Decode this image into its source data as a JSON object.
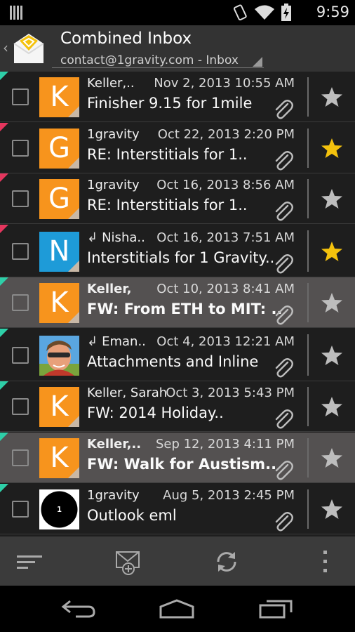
{
  "status_bar": {
    "time": "9:59",
    "icons": [
      "notification-icon",
      "rotate-icon",
      "wifi-icon",
      "battery-charging-icon"
    ]
  },
  "action_bar": {
    "title": "Combined Inbox",
    "account": "contact@1gravity.com - Inbox"
  },
  "messages": [
    {
      "sender": "Keller,..",
      "date": "Nov 2, 2013 10:55 AM",
      "subject": "Finisher 9.15 for 1mile",
      "avatar_letter": "K",
      "avatar_color": "#F7941D",
      "starred": false,
      "unread": false,
      "replied": false,
      "has_attachment": true,
      "account_color": "#2ECFA8"
    },
    {
      "sender": "1gravity",
      "date": "Oct 22, 2013 2:20 PM",
      "subject": "RE: Interstitials for 1..",
      "avatar_letter": "G",
      "avatar_color": "#F7941D",
      "starred": true,
      "unread": false,
      "replied": false,
      "has_attachment": true,
      "account_color": "#E5365E"
    },
    {
      "sender": "1gravity",
      "date": "Oct 16, 2013 8:56 AM",
      "subject": "RE: Interstitials for 1..",
      "avatar_letter": "G",
      "avatar_color": "#F7941D",
      "starred": false,
      "unread": false,
      "replied": false,
      "has_attachment": true,
      "account_color": "#E5365E"
    },
    {
      "sender": "Nisha..",
      "date": "Oct 16, 2013 7:51 AM",
      "subject": "Interstitials for 1 Gravity..",
      "avatar_letter": "N",
      "avatar_color": "#1E9BD8",
      "starred": true,
      "unread": false,
      "replied": true,
      "has_attachment": true,
      "account_color": "#E5365E"
    },
    {
      "sender": "Keller,",
      "date": "Oct 10, 2013 8:41 AM",
      "subject": "FW: From ETH to MIT: ..",
      "avatar_letter": "K",
      "avatar_color": "#F7941D",
      "starred": false,
      "unread": true,
      "replied": false,
      "has_attachment": true,
      "account_color": "#2ECFA8"
    },
    {
      "sender": "Eman..",
      "date": "Oct 4, 2013 12:21 AM",
      "subject": "Attachments and Inline",
      "avatar_letter": "",
      "avatar_color": "#3E8FD0",
      "starred": false,
      "unread": false,
      "replied": true,
      "has_attachment": true,
      "account_color": "#2ECFA8"
    },
    {
      "sender": "Keller, Sarah",
      "date": "Oct 3, 2013 5:43 PM",
      "subject": "FW: 2014 Holiday..",
      "avatar_letter": "K",
      "avatar_color": "#F7941D",
      "starred": false,
      "unread": false,
      "replied": false,
      "has_attachment": true,
      "account_color": "#2ECFA8"
    },
    {
      "sender": "Keller,..",
      "date": "Sep 12, 2013 4:11 PM",
      "subject": "FW: Walk for Austism..",
      "avatar_letter": "K",
      "avatar_color": "#F7941D",
      "starred": false,
      "unread": true,
      "replied": false,
      "has_attachment": true,
      "account_color": "#2ECFA8"
    },
    {
      "sender": "1gravity",
      "date": "Aug 5, 2013 2:45 PM",
      "subject": "Outlook eml",
      "avatar_letter": "1 gravity",
      "avatar_color": "#000000",
      "starred": false,
      "unread": false,
      "replied": false,
      "has_attachment": true,
      "account_color": "#2ECFA8"
    }
  ],
  "bottom_bar": {
    "buttons": [
      "sort-icon",
      "compose-icon",
      "refresh-icon",
      "overflow-menu-icon"
    ]
  },
  "nav_bar": {
    "buttons": [
      "back-icon",
      "home-icon",
      "recent-apps-icon"
    ]
  },
  "colors": {
    "star_on": "#F4C20D",
    "star_off": "#BDBDBD",
    "read_row": "#1E1E1E",
    "unread_row": "#545151"
  }
}
